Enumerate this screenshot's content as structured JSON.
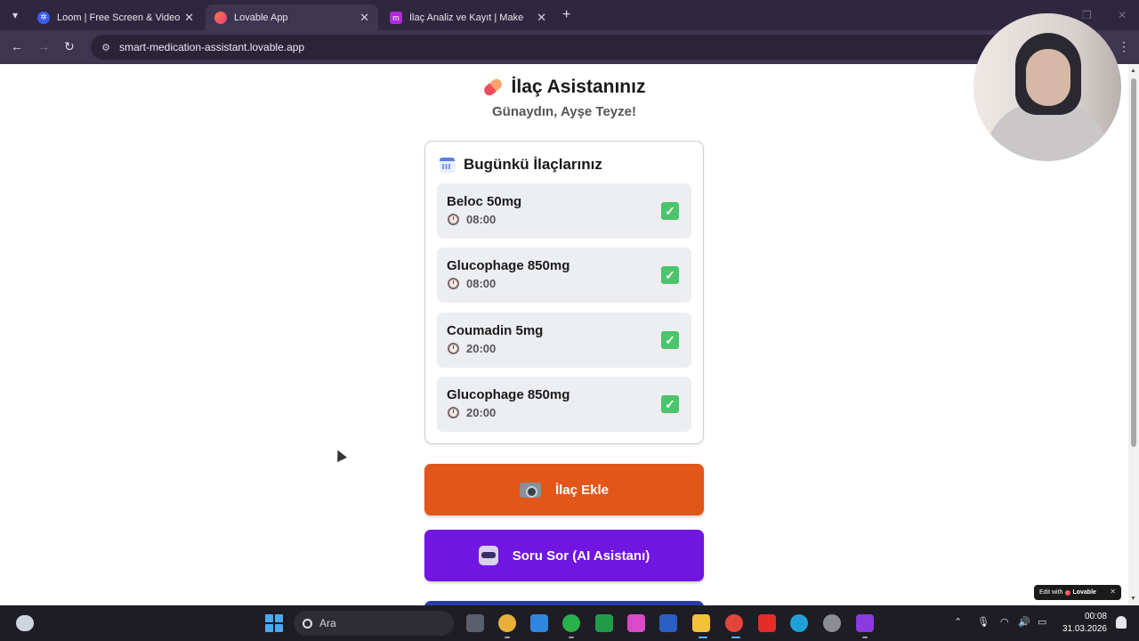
{
  "browser": {
    "tabs": [
      {
        "title": "Loom | Free Screen & Video Re",
        "active": false
      },
      {
        "title": "Lovable App",
        "active": true
      },
      {
        "title": "İlaç Analiz ve Kayıt | Make",
        "active": false
      }
    ],
    "url": "smart-medication-assistant.lovable.app"
  },
  "app": {
    "title": "İlaç Asistanınız",
    "greeting": "Günaydın, Ayşe Teyze!",
    "today_heading": "Bugünkü İlaçlarınız",
    "medications": [
      {
        "name": "Beloc 50mg",
        "time": "08:00",
        "taken": true
      },
      {
        "name": "Glucophage 850mg",
        "time": "08:00",
        "taken": true
      },
      {
        "name": "Coumadin 5mg",
        "time": "20:00",
        "taken": true
      },
      {
        "name": "Glucophage 850mg",
        "time": "20:00",
        "taken": true
      }
    ],
    "buttons": {
      "add_label": "İlaç Ekle",
      "ask_label": "Soru Sor (AI Asistanı)"
    },
    "colors": {
      "add_button": "#e2561a",
      "ask_button": "#7016e0",
      "third_button": "#283aa8",
      "check": "#4cc46b"
    }
  },
  "edit_badge": {
    "prefix": "Edit with",
    "brand": "Lovable"
  },
  "taskbar": {
    "search_placeholder": "Ara",
    "time": "00:08",
    "date": "31.03.2026"
  }
}
